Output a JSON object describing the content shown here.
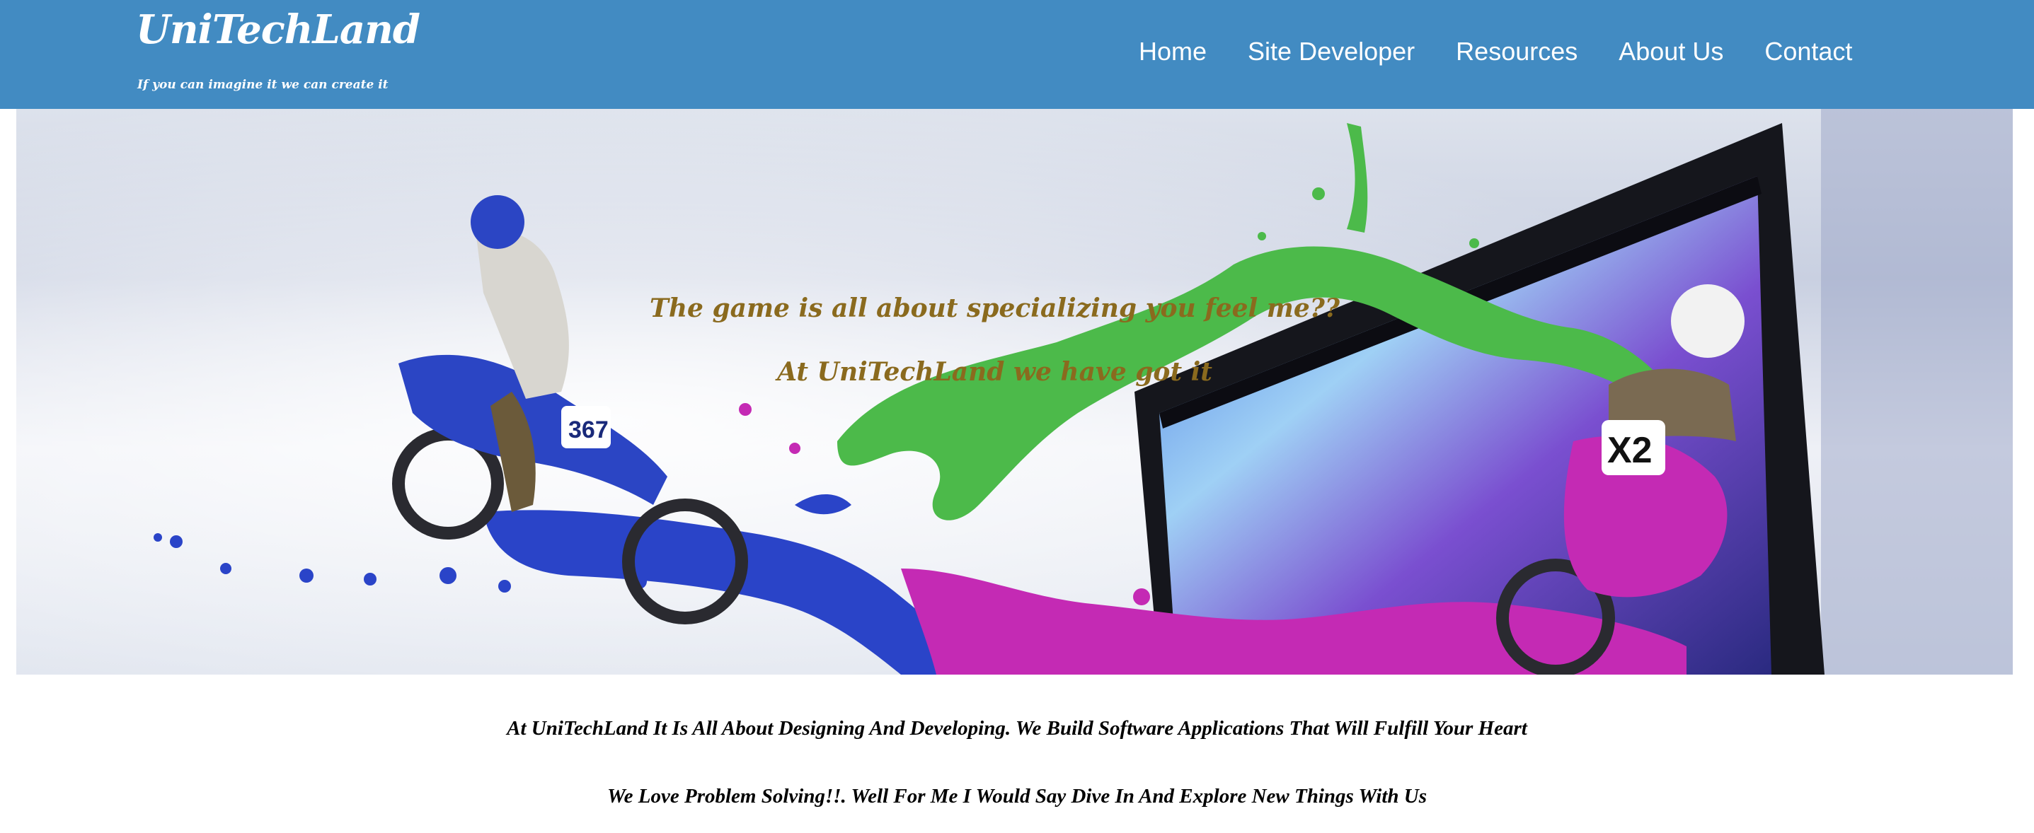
{
  "header": {
    "logo": "UniTechLand",
    "tagline": "If you can imagine it we can create it",
    "nav": [
      "Home",
      "Site Developer",
      "Resources",
      "About Us",
      "Contact"
    ]
  },
  "hero": {
    "headline": "The game is all about specializing you feel me??",
    "subheadline": "At UniTechLand we have got it",
    "rider_left_number": "367",
    "rider_right_number": "X2",
    "colors": {
      "headline": "#8a6a1e",
      "paint_blue": "#2a44c8",
      "paint_green": "#48b848",
      "paint_magenta": "#c42ab4"
    }
  },
  "intro": {
    "line1": "At UniTechLand It Is All About Designing And Developing. We Build Software Applications That Will Fulfill Your Heart",
    "line2": "We Love Problem Solving!!. Well For Me I Would Say Dive In And Explore New Things With Us"
  },
  "colors": {
    "header_bg": "#428bc2",
    "header_text": "#ffffff"
  }
}
